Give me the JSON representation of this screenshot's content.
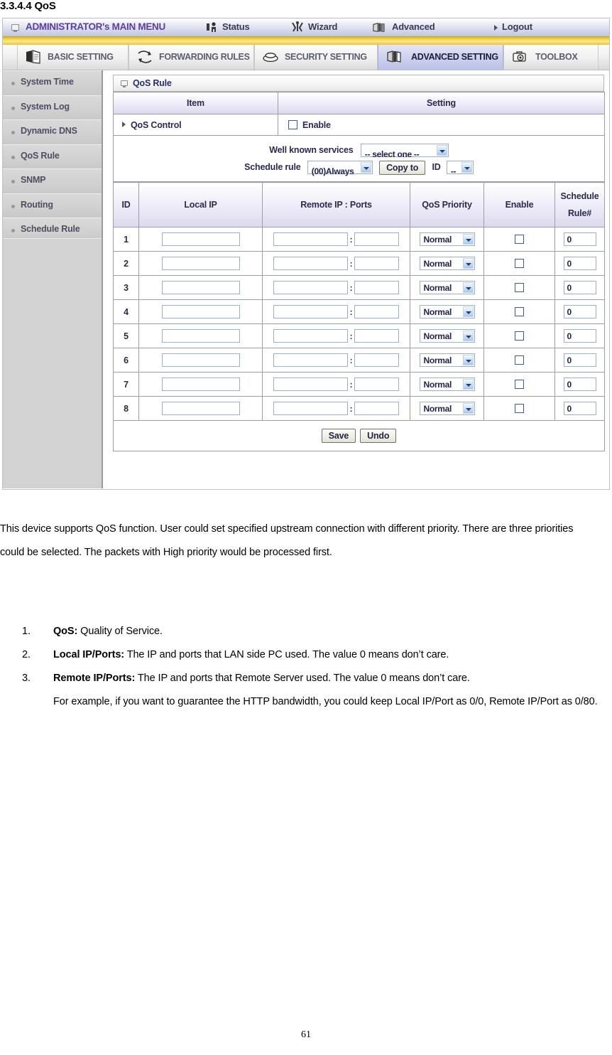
{
  "heading": "3.3.4.4 QoS",
  "router_ui": {
    "admin_bar": {
      "title": "ADMINISTRATOR's MAIN MENU",
      "monitor_icon": "monitor-icon",
      "nav": [
        {
          "label": "Status",
          "icon": "status-person-icon"
        },
        {
          "label": "Wizard",
          "icon": "wizard-wand-icon"
        },
        {
          "label": "Advanced",
          "icon": "advanced-book-icon"
        },
        {
          "label": "Logout",
          "icon": "arrow-right-icon"
        }
      ]
    },
    "tabs": [
      {
        "label": "BASIC SETTING",
        "icon": "books-icon",
        "active": false
      },
      {
        "label": "FORWARDING RULES",
        "icon": "arrows-icon",
        "active": false
      },
      {
        "label": "SECURITY SETTING",
        "icon": "shield-icon",
        "active": false
      },
      {
        "label": "ADVANCED SETTING",
        "icon": "advanced-box-icon",
        "active": true
      },
      {
        "label": "TOOLBOX",
        "icon": "toolbox-gear-icon",
        "active": false
      }
    ],
    "sidebar": {
      "items": [
        {
          "label": "System Time"
        },
        {
          "label": "System Log"
        },
        {
          "label": "Dynamic DNS"
        },
        {
          "label": "QoS Rule"
        },
        {
          "label": "SNMP"
        },
        {
          "label": "Routing"
        },
        {
          "label": "Schedule Rule"
        }
      ]
    },
    "panel": {
      "title": "QoS Rule",
      "columns_top": {
        "item": "Item",
        "setting": "Setting"
      },
      "qos_control": {
        "label": "QoS Control",
        "enable_label": "Enable",
        "enabled": false
      },
      "services": {
        "well_known_label": "Well known services",
        "well_known_value": "-- select one --",
        "schedule_rule_label": "Schedule rule",
        "schedule_rule_value": "(00)Always",
        "copy_to_label": "Copy to",
        "id_label": "ID",
        "id_value": "--"
      },
      "table_headers": {
        "id": "ID",
        "local_ip": "Local IP",
        "remote_ip_ports": "Remote IP : Ports",
        "qos_priority": "QoS Priority",
        "enable": "Enable",
        "schedule_rule_line1": "Schedule",
        "schedule_rule_line2": "Rule#"
      },
      "rows": [
        {
          "id": "1",
          "local_ip": "",
          "remote_ip": "",
          "remote_ports": "",
          "priority": "Normal",
          "enable": false,
          "schedule_rule": "0"
        },
        {
          "id": "2",
          "local_ip": "",
          "remote_ip": "",
          "remote_ports": "",
          "priority": "Normal",
          "enable": false,
          "schedule_rule": "0"
        },
        {
          "id": "3",
          "local_ip": "",
          "remote_ip": "",
          "remote_ports": "",
          "priority": "Normal",
          "enable": false,
          "schedule_rule": "0"
        },
        {
          "id": "4",
          "local_ip": "",
          "remote_ip": "",
          "remote_ports": "",
          "priority": "Normal",
          "enable": false,
          "schedule_rule": "0"
        },
        {
          "id": "5",
          "local_ip": "",
          "remote_ip": "",
          "remote_ports": "",
          "priority": "Normal",
          "enable": false,
          "schedule_rule": "0"
        },
        {
          "id": "6",
          "local_ip": "",
          "remote_ip": "",
          "remote_ports": "",
          "priority": "Normal",
          "enable": false,
          "schedule_rule": "0"
        },
        {
          "id": "7",
          "local_ip": "",
          "remote_ip": "",
          "remote_ports": "",
          "priority": "Normal",
          "enable": false,
          "schedule_rule": "0"
        },
        {
          "id": "8",
          "local_ip": "",
          "remote_ip": "",
          "remote_ports": "",
          "priority": "Normal",
          "enable": false,
          "schedule_rule": "0"
        }
      ],
      "buttons": {
        "save": "Save",
        "undo": "Undo"
      }
    }
  },
  "body": {
    "intro": "This device supports QoS function. User could set specified upstream connection with different priority. There are three priorities could be selected. The packets with High priority would be processed first.",
    "items": [
      {
        "num": "1.",
        "term": "QoS:",
        "text": " Quality of Service."
      },
      {
        "num": "2.",
        "term": "Local IP/Ports:",
        "text": " The IP and ports that LAN side PC used. The value 0 means don’t care."
      },
      {
        "num": "3.",
        "term": "Remote IP/Ports:",
        "text": " The IP and ports that Remote Server used. The value 0 means don’t care.",
        "extra": "For example, if you want to guarantee the HTTP bandwidth, you could keep Local IP/Port as 0/0, Remote IP/Port as 0/80."
      }
    ]
  },
  "page_number": "61"
}
